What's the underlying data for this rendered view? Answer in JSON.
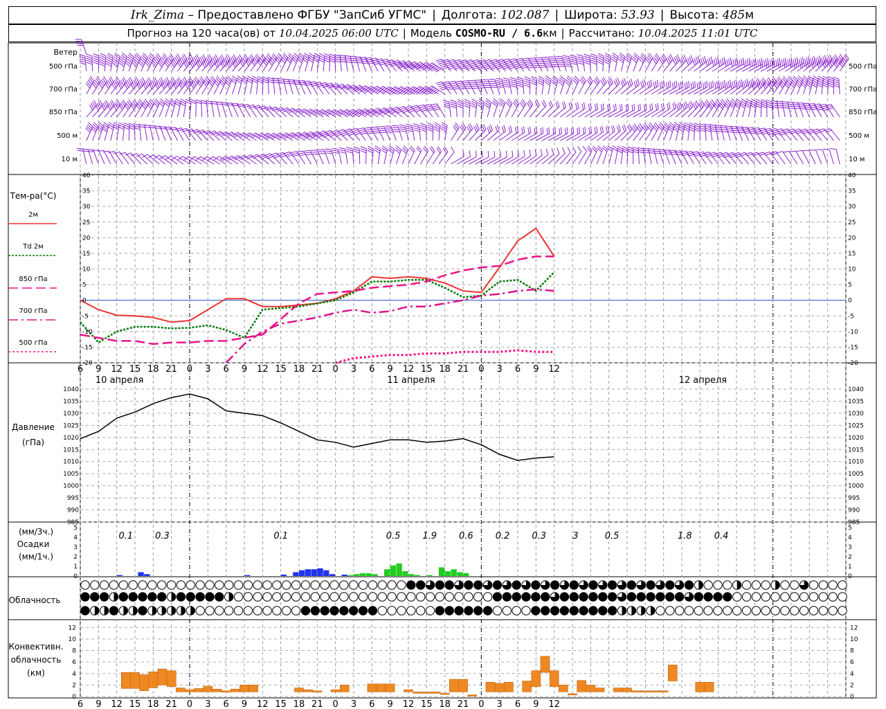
{
  "header": {
    "station": "Irk_Zima",
    "dash": " – ",
    "provider": "Предоставлено ФГБУ \"ЗапСиб УГМС\"",
    "lon_label": "Долгота:",
    "lon": "102.087",
    "lat_label": "Широта:",
    "lat": "53.93",
    "alt_label": "Высота:",
    "alt": "485",
    "alt_unit": "м",
    "forecast_prefix": "Прогноз на 120 часа(ов) от",
    "forecast_time": "10.04.2025 06:00 UTC",
    "model_label": "Модель",
    "model": "COSMO-RU / 6.6",
    "model_unit": "км",
    "calc_label": "Рассчитано:",
    "calc_time": "10.04.2025 11:01 UTC"
  },
  "labels": {
    "wind": "Ветер",
    "wind_levels": [
      "500 гПа",
      "700 гПа",
      "850 гПа",
      "500 м",
      "10 м"
    ],
    "temp_title": "Тем-ра(°С)",
    "temp_legend": [
      "2м",
      "Td 2м",
      "850 гПа",
      "700 гПа",
      "500 гПа"
    ],
    "pressure_title": "Давление",
    "pressure_unit": "(гПа)",
    "precip_3h": "(мм/3ч.)",
    "precip_title": "Осадки",
    "precip_1h": "(мм/1ч.)",
    "cloud_title": "Облачность",
    "conv_title": [
      "Конвективн.",
      "облачность",
      "(км)"
    ],
    "dates": [
      "10 апреля",
      "11 апреля",
      "12 апреля"
    ]
  },
  "colors": {
    "t2m": "#ee3333",
    "td2m": "#007700",
    "t850": "#ee1188",
    "t700": "#dd1188",
    "t500": "#ee1188",
    "wind": "#8822cc",
    "rain_blue": "#2233ee",
    "rain_green": "#22cc22",
    "conv": "#ee8822"
  },
  "chart_data": [
    {
      "type": "line",
      "name": "temperature",
      "x_hours": [
        6,
        9,
        12,
        15,
        18,
        21,
        0,
        3,
        6,
        9,
        12,
        15,
        18,
        21,
        0,
        3,
        6,
        9,
        12,
        15,
        18,
        21,
        0,
        3,
        6,
        9,
        12
      ],
      "ylim": [
        -20,
        40
      ],
      "yticks": [
        -20,
        -15,
        -10,
        -5,
        0,
        5,
        10,
        15,
        20,
        25,
        30,
        35,
        40
      ],
      "series": [
        {
          "name": "2м",
          "values": [
            0,
            -3,
            -4.8,
            -5,
            -5.5,
            -7,
            -6.5,
            -3,
            0.5,
            0.5,
            -2,
            -2,
            -1.5,
            -1,
            0.5,
            3,
            7.5,
            7,
            7.5,
            7,
            5.5,
            3,
            2.5,
            10.5,
            19,
            23,
            14
          ]
        },
        {
          "name": "Td 2м",
          "values": [
            -7,
            -13.5,
            -10,
            -8.5,
            -8.5,
            -9,
            -8.8,
            -8,
            -9.5,
            -12,
            -3,
            -2.5,
            -2,
            -1,
            0,
            2.5,
            6,
            6,
            6.5,
            6.5,
            4,
            1,
            1.5,
            6,
            6.5,
            3,
            9
          ]
        },
        {
          "name": "850 гПа",
          "values": [
            -11,
            -12,
            -13,
            -13,
            -14,
            -13.5,
            -13.5,
            -13,
            -13,
            -12,
            -11,
            -6,
            -1,
            2,
            2.5,
            3,
            4,
            4.5,
            5,
            6,
            8,
            9.5,
            10.5,
            11,
            13,
            14,
            14
          ]
        },
        {
          "name": "700 гПа",
          "values": [
            null,
            null,
            null,
            null,
            null,
            null,
            null,
            null,
            -20,
            -14,
            -10,
            -7.5,
            -6.5,
            -5.5,
            -4,
            -3,
            -4,
            -3.5,
            -2,
            -2,
            -1,
            0,
            1.5,
            2,
            3,
            3.5,
            3
          ]
        },
        {
          "name": "500 гПа",
          "values": [
            null,
            null,
            null,
            null,
            null,
            null,
            null,
            null,
            null,
            null,
            null,
            null,
            null,
            null,
            -20,
            -18.5,
            -18,
            -17.5,
            -17.5,
            -17,
            -17,
            -16.5,
            -16.5,
            -16.5,
            -16,
            -16.5,
            -16.5
          ]
        }
      ]
    },
    {
      "type": "line",
      "name": "pressure",
      "x_hours": [
        6,
        9,
        12,
        15,
        18,
        21,
        0,
        3,
        6,
        9,
        12,
        15,
        18,
        21,
        0,
        3,
        6,
        9,
        12,
        15,
        18,
        21,
        0,
        3,
        6,
        9,
        12
      ],
      "ylim": [
        985,
        1040
      ],
      "yticks": [
        985,
        990,
        995,
        1000,
        1005,
        1010,
        1015,
        1020,
        1025,
        1030,
        1035,
        1040
      ],
      "values": [
        1019.5,
        1022.5,
        1028,
        1030.5,
        1034,
        1036.5,
        1038,
        1036,
        1031,
        1030,
        1029,
        1026,
        1022.5,
        1019,
        1018,
        1016,
        1017.5,
        1019,
        1019,
        1018,
        1018.5,
        1019.5,
        1017,
        1013,
        1010.5,
        1011.5,
        1012
      ]
    },
    {
      "type": "bar",
      "name": "precipitation",
      "ylim": [
        0,
        5
      ],
      "totals_3h": [
        "0.1",
        "0.3",
        "0.1",
        "0.5",
        "1.9",
        "0.6",
        "0.2",
        "0.3",
        "3",
        "0.5",
        "1.8",
        "0.4"
      ],
      "blue_hours": [
        [
          6,
          0.1
        ],
        [
          9.5,
          0.4
        ],
        [
          10.5,
          0.2
        ],
        [
          27,
          0.1
        ],
        [
          33,
          0.15
        ],
        [
          35,
          0.4
        ],
        [
          36,
          0.6
        ],
        [
          37,
          0.7
        ],
        [
          38,
          0.7
        ],
        [
          39,
          0.8
        ],
        [
          40,
          0.6
        ],
        [
          41,
          0.2
        ],
        [
          43,
          0.15
        ]
      ],
      "green_hours": [
        [
          44,
          0.1
        ],
        [
          45,
          0.2
        ],
        [
          46,
          0.3
        ],
        [
          47,
          0.3
        ],
        [
          48,
          0.2
        ],
        [
          50,
          0.7
        ],
        [
          51,
          1.1
        ],
        [
          52,
          1.3
        ],
        [
          53,
          0.5
        ],
        [
          54,
          0.2
        ],
        [
          55,
          0.1
        ],
        [
          57,
          0.1
        ],
        [
          59,
          0.9
        ],
        [
          60,
          0.5
        ],
        [
          61,
          0.7
        ],
        [
          62,
          0.4
        ],
        [
          63,
          0.3
        ]
      ]
    },
    {
      "type": "table",
      "name": "cloudiness",
      "rows": [
        "OOOOOOOOOOOOOOOOOOOOOOOOOOOOOOOOOOOOOOOOOOOOOOOOOOOOOOOOOOOOOOOOOOOOOOOOOOOOOOOO",
        "OOOOOOOOOOOOOOOOOOOOOOOOOOOOOOOOOOOOOOOOOOOOOOOOOOOOOOOOOOOOOOOOOOOOOOOOOOOOOOOO",
        "OOOOOOOOOOOOOOOOOOOOOOOOOOOOOOOOOOOOOOOOOOOOOOOOOOOOOOOOOOOOOOOOOOOOOOOOOOOOOOOO"
      ]
    },
    {
      "type": "bar",
      "name": "convective_cloud",
      "ylim": [
        0,
        13
      ],
      "yticks": [
        0,
        2,
        4,
        6,
        8,
        10,
        12
      ],
      "bars": [
        [
          6.5,
          1,
          4.2
        ],
        [
          7.5,
          1,
          4.2
        ],
        [
          8.5,
          1,
          3.8
        ],
        [
          9.5,
          1,
          4.3
        ],
        [
          10.5,
          1,
          4.8
        ],
        [
          11.5,
          1,
          4.5
        ],
        [
          12.5,
          1,
          1.5
        ],
        [
          13.5,
          1,
          1.2
        ],
        [
          14.5,
          1,
          1.4
        ],
        [
          15.5,
          1,
          1.8
        ],
        [
          16.5,
          1,
          1.3
        ],
        [
          17.5,
          1,
          1.0
        ],
        [
          18.5,
          1,
          1.3
        ],
        [
          19.5,
          1,
          2.0
        ],
        [
          20.5,
          1,
          2.0
        ],
        [
          25.5,
          1,
          1.5
        ],
        [
          26.5,
          1,
          1.2
        ],
        [
          27.5,
          1,
          1.0
        ],
        [
          29.5,
          1,
          1.2
        ],
        [
          30.5,
          1,
          2.0
        ],
        [
          33.5,
          1,
          2.2
        ],
        [
          34.5,
          1,
          2.2
        ],
        [
          35.5,
          1,
          2.2
        ],
        [
          37.5,
          1,
          1.2
        ],
        [
          38.5,
          1,
          0.8
        ],
        [
          39.5,
          1,
          0.8
        ],
        [
          40.5,
          1,
          0.8
        ],
        [
          41.5,
          1,
          0.6
        ],
        [
          42.5,
          1,
          3.0
        ],
        [
          43.5,
          1,
          3.0
        ],
        [
          44.5,
          1,
          0.3
        ],
        [
          46.5,
          1,
          2.5
        ],
        [
          47.5,
          1,
          2.3
        ],
        [
          48.5,
          1,
          2.5
        ],
        [
          50.5,
          1,
          2.7
        ],
        [
          51.5,
          1,
          4.5
        ],
        [
          52.5,
          1,
          7.0
        ],
        [
          53.5,
          1,
          4.5
        ],
        [
          54.5,
          1,
          2.0
        ],
        [
          55.5,
          1,
          0.5
        ],
        [
          56.5,
          1,
          2.8
        ],
        [
          57.5,
          1,
          2.0
        ],
        [
          58.5,
          1,
          1.5
        ],
        [
          60.5,
          1,
          1.5
        ],
        [
          61.5,
          1,
          1.5
        ],
        [
          62.5,
          1,
          1.0
        ],
        [
          63.5,
          1,
          1.0
        ],
        [
          64.5,
          1,
          1.0
        ],
        [
          65.5,
          1,
          1.0
        ],
        [
          66.5,
          1,
          5.5
        ],
        [
          69.5,
          1,
          2.5
        ],
        [
          70.5,
          1,
          2.5
        ]
      ]
    }
  ],
  "x_tick_labels": [
    "6",
    "9",
    "12",
    "15",
    "18",
    "21",
    "0",
    "3",
    "6",
    "9",
    "12",
    "15",
    "18",
    "21",
    "0",
    "3",
    "6",
    "9",
    "12",
    "15",
    "18",
    "21",
    "0",
    "3",
    "6",
    "9",
    "12"
  ]
}
